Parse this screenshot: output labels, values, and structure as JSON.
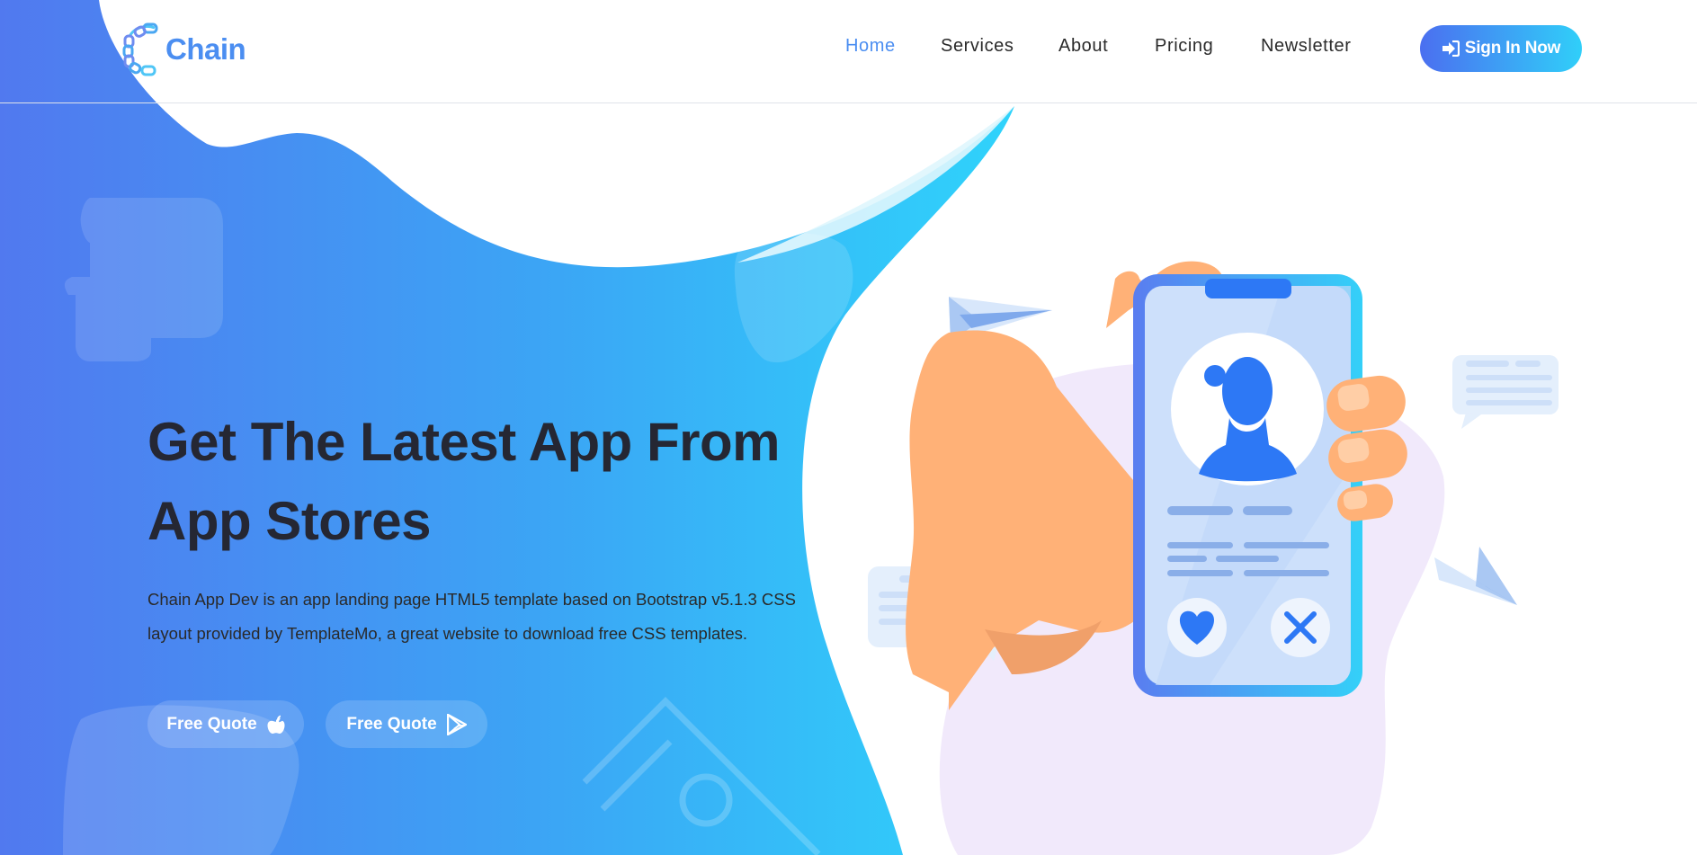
{
  "brand": {
    "name": "Chain",
    "logo_icon": "chain-link-icon",
    "color": "#4b8ef1"
  },
  "nav": {
    "items": [
      {
        "label": "Home",
        "active": true
      },
      {
        "label": "Services",
        "active": false
      },
      {
        "label": "About",
        "active": false
      },
      {
        "label": "Pricing",
        "active": false
      },
      {
        "label": "Newsletter",
        "active": false
      }
    ],
    "active_color": "#4b8ef1",
    "text_color": "#2a2a2a",
    "signin_label": "Sign In Now",
    "signin_icon": "sign-in-arrow-icon"
  },
  "hero": {
    "title_line1": "Get The Latest App From",
    "title_line2": "App Stores",
    "description_line1": "Chain App Dev is an app landing page HTML5 template based on Bootstrap v5.1.3 CSS",
    "description_line2": "layout provided by TemplateMo, a great website to download free CSS templates.",
    "buttons": [
      {
        "label": "Free Quote",
        "icon": "apple-icon"
      },
      {
        "label": "Free Quote",
        "icon": "play-store-icon"
      }
    ]
  },
  "colors": {
    "gradient_start": "#5179ef",
    "gradient_end": "#30cff9",
    "title": "#252733",
    "phone_accent": "#2d78f5",
    "skin": "#ffb177"
  }
}
